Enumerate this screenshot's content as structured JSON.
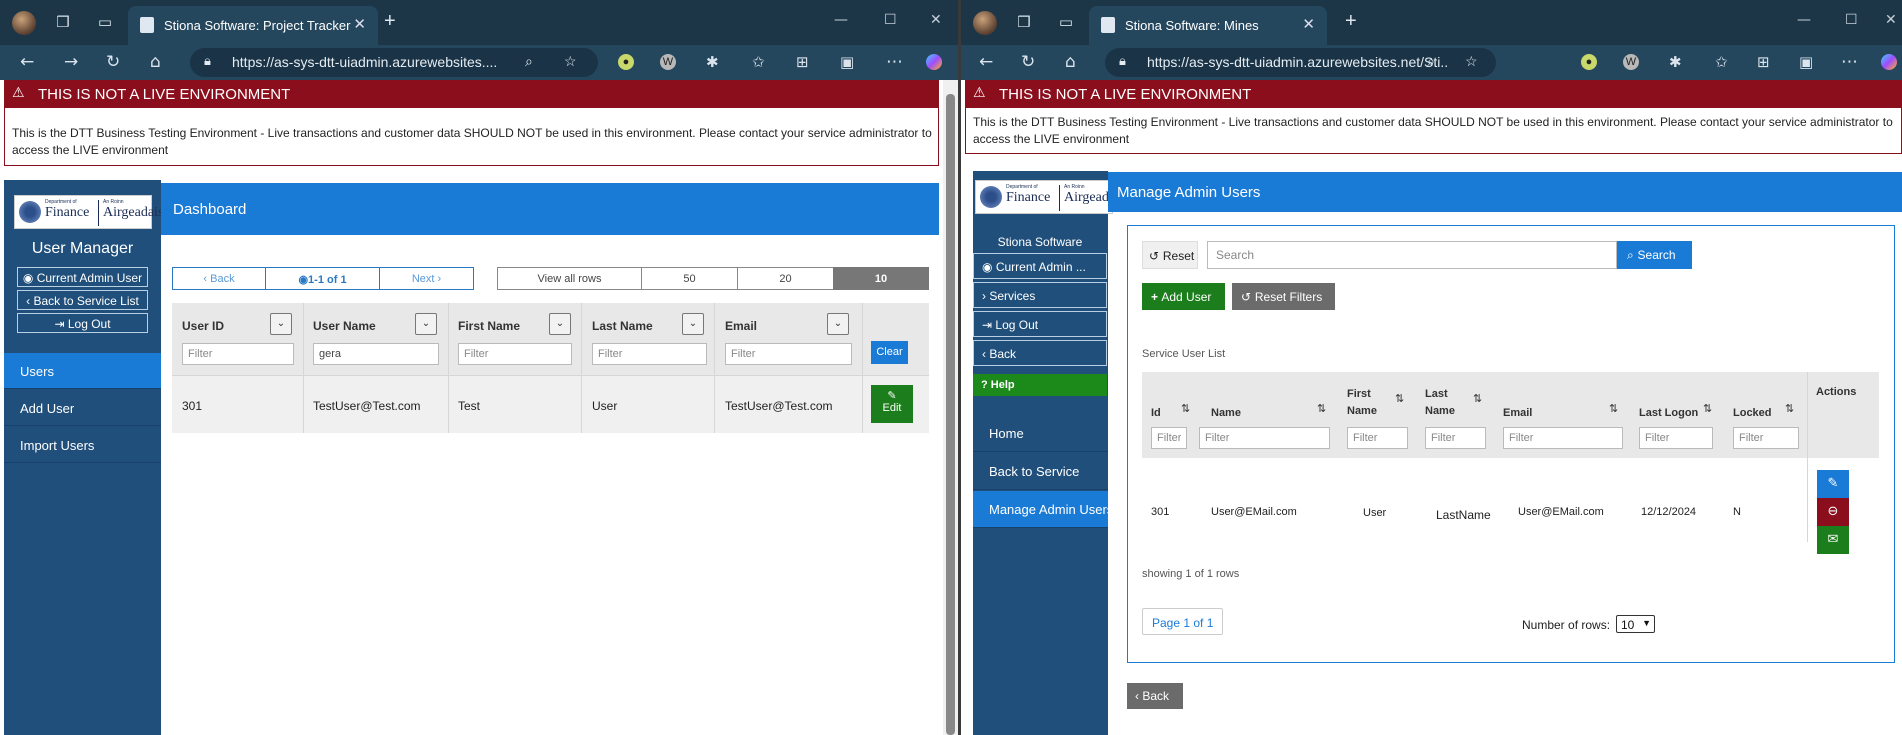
{
  "left": {
    "tab_title": "Stiona Software: Project Tracker",
    "url": "https://as-sys-dtt-uiadmin.azurewebsites....",
    "warning": {
      "title": "THIS IS NOT A LIVE ENVIRONMENT",
      "text": "This is the DTT Business Testing Environment - Live transactions and customer data SHOULD NOT be used in this environment. Please contact your service administrator to access the LIVE environment"
    },
    "logo": {
      "dept": "Department of",
      "finance": "Finance",
      "irish": "An Roinn",
      "airgeadais": "Airgeadais"
    },
    "app_title": "User Manager",
    "side_buttons": [
      "Current Admin User",
      "Back to Service List",
      "Log Out"
    ],
    "nav": [
      "Users",
      "Add User",
      "Import Users"
    ],
    "page_title": "Dashboard",
    "pager": {
      "back": "Back",
      "info": "1-1 of 1",
      "next": "Next"
    },
    "rows_options": [
      "View all rows",
      "50",
      "20",
      "10"
    ],
    "columns": [
      "User ID",
      "User Name",
      "First Name",
      "Last Name",
      "Email"
    ],
    "filter_placeholder": "Filter",
    "filter_values": {
      "user_name": "gera"
    },
    "clear_label": "Clear",
    "row": {
      "id": "301",
      "user_name": "TestUser@Test.com",
      "first_name": "Test",
      "last_name": "User",
      "email": "TestUser@Test.com"
    },
    "edit_label": "Edit"
  },
  "right": {
    "tab_title": "Stiona Software: Mines",
    "url": "https://as-sys-dtt-uiadmin.azurewebsites.net/Sti...",
    "warning": {
      "title": "THIS IS NOT A LIVE ENVIRONMENT",
      "text": "This is the DTT Business Testing Environment - Live transactions and customer data SHOULD NOT be used in this environment. Please contact your service administrator to access the LIVE environment"
    },
    "logo": {
      "dept": "Department of",
      "finance": "Finance",
      "irish": "An Roinn",
      "airgeadais": "Airgeadais"
    },
    "app_title": "Stiona Software",
    "side_buttons": [
      "Current Admin ...",
      "Services",
      "Log Out",
      "Back"
    ],
    "help_label": "Help",
    "nav": [
      "Home",
      "Back to Service",
      "Manage Admin Users"
    ],
    "page_title": "Manage Admin Users",
    "reset_label": "Reset",
    "search_placeholder": "Search",
    "search_label": "Search",
    "add_user_label": "Add User",
    "reset_filters_label": "Reset Filters",
    "list_title": "Service User List",
    "columns": [
      "Id",
      "Name",
      "First Name",
      "Last Name",
      "Email",
      "Last Logon",
      "Locked",
      "Actions"
    ],
    "filter_placeholder": "Filter",
    "row": {
      "id": "301",
      "name": "User@EMail.com",
      "first_name": "User",
      "last_name": "LastName",
      "email": "User@EMail.com",
      "last_logon": "12/12/2024",
      "locked": "N"
    },
    "showing": "showing 1 of 1 rows",
    "page_label": "Page 1 of 1",
    "rows_label": "Number of rows:",
    "rows_value": "10",
    "back_label": "Back"
  },
  "colors": {
    "accent": "#1a7bd6",
    "sidebar": "#1f4f7a",
    "warning": "#8b0e1c",
    "green": "#1b7d1b",
    "grey": "#6b6b6b"
  }
}
